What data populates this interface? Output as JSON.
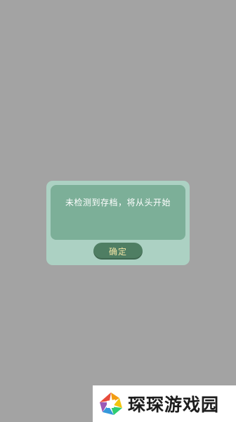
{
  "dialog": {
    "message": "未检测到存档，将从头开始",
    "confirm_label": "确定"
  },
  "watermark": {
    "brand": "琛琛游戏园"
  },
  "colors": {
    "backdrop": "#a3a3a3",
    "dialog_bg": "#acd1c3",
    "message_panel": "#7caf98",
    "button_bg": "#4f7e63",
    "button_text": "#f3e6a6"
  }
}
